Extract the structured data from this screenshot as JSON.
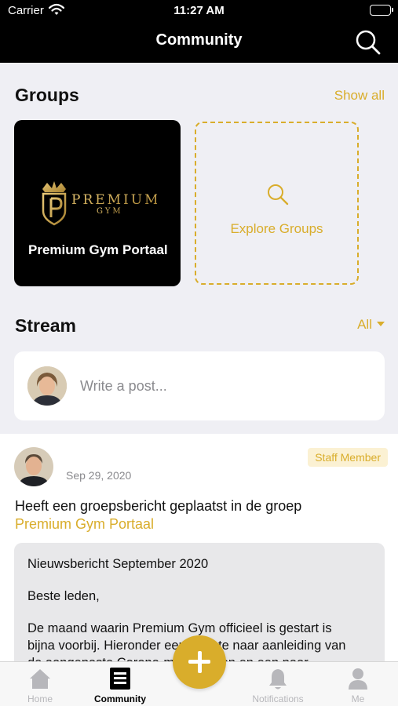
{
  "status_bar": {
    "carrier": "Carrier",
    "time": "11:27 AM"
  },
  "nav": {
    "title": "Community"
  },
  "groups": {
    "title": "Groups",
    "show_all": "Show all",
    "items": [
      {
        "name": "Premium Gym Portaal",
        "logo_text": "PREMIUM",
        "logo_subtext": "GYM"
      }
    ],
    "explore_label": "Explore Groups"
  },
  "stream": {
    "title": "Stream",
    "filter": "All",
    "composer_placeholder": "Write a post..."
  },
  "post": {
    "date": "Sep 29, 2020",
    "badge": "Staff Member",
    "action": "Heeft een groepsbericht geplaatst in de groep",
    "group": "Premium Gym Portaal",
    "body_title": "Nieuwsbericht  September 2020",
    "body_greeting": "Beste leden,",
    "body_line1": "De maand waarin Premium Gym officieel is gestart is",
    "body_line2": "bijna voorbij. Hieronder een update naar aanleiding van",
    "body_line3": "de aangepaste Corona-maatregelen en een paar"
  },
  "tabs": [
    {
      "label": "Home",
      "icon": "home-icon",
      "active": false
    },
    {
      "label": "Community",
      "icon": "feed-icon",
      "active": true
    },
    {
      "label": "Notifications",
      "icon": "bell-icon",
      "active": false
    },
    {
      "label": "Me",
      "icon": "person-icon",
      "active": false
    }
  ],
  "colors": {
    "accent": "#d9ad2b",
    "header": "#000000",
    "background": "#efeff4"
  }
}
